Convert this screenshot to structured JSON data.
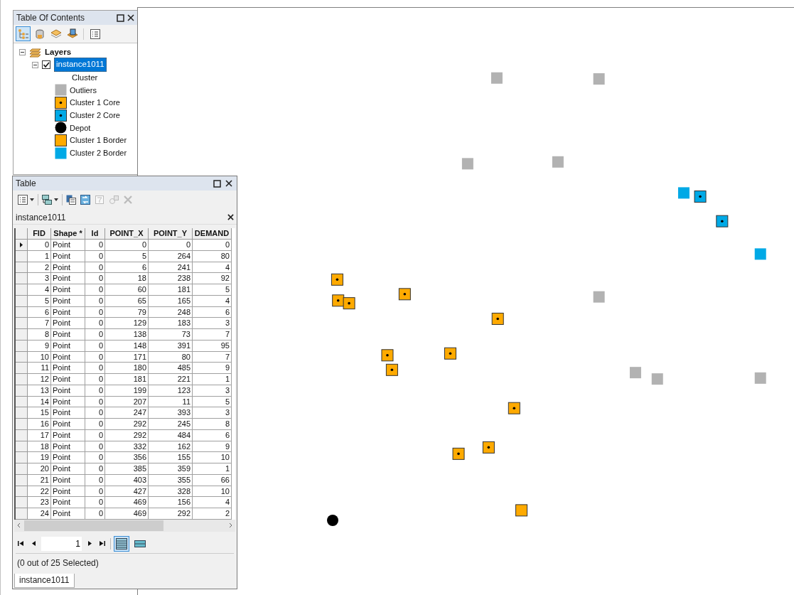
{
  "toc": {
    "title": "Table Of Contents",
    "toolbar": [
      {
        "kind": "drawing-order",
        "selected": true
      },
      {
        "kind": "source",
        "selected": false
      },
      {
        "kind": "visibility",
        "selected": false
      },
      {
        "kind": "selection",
        "selected": false
      },
      {
        "kind": "options",
        "selected": false
      }
    ],
    "tree": [
      {
        "label": "Layers",
        "expanded": true,
        "children": [
          {
            "label": "instance1011",
            "expanded": true,
            "checked": true,
            "selected": true,
            "field": "Cluster",
            "legend": [
              {
                "label": "Outliers",
                "kind": "square",
                "color": "#b2b2b2",
                "outline": false
              },
              {
                "label": "Cluster 1 Core",
                "kind": "dot-square",
                "color": "#ffaa00",
                "outline": true
              },
              {
                "label": "Cluster 2 Core",
                "kind": "dot-square",
                "color": "#00a9e6",
                "outline": true
              },
              {
                "label": "Depot",
                "kind": "circle",
                "color": "#000000",
                "outline": false
              },
              {
                "label": "Cluster 1 Border",
                "kind": "square",
                "color": "#ffaa00",
                "outline": true
              },
              {
                "label": "Cluster 2 Border",
                "kind": "square",
                "color": "#00a9e6",
                "outline": false
              }
            ]
          }
        ]
      }
    ]
  },
  "table": {
    "title": "Table",
    "tab": "instance1011",
    "tools": [
      {
        "kind": "options",
        "disabled": false
      },
      {
        "kind": "related",
        "disabled": false
      },
      {
        "kind": "select-by-attributes",
        "disabled": false
      },
      {
        "kind": "switch-selection",
        "disabled": false
      },
      {
        "kind": "clear-selection",
        "disabled": true
      },
      {
        "kind": "zoom-selected",
        "disabled": true
      },
      {
        "kind": "delete",
        "disabled": true
      }
    ],
    "columns": [
      {
        "label": "FID",
        "kind": "number"
      },
      {
        "label": "Shape *",
        "kind": "text"
      },
      {
        "label": "Id",
        "kind": "number"
      },
      {
        "label": "POINT_X",
        "kind": "number"
      },
      {
        "label": "POINT_Y",
        "kind": "number"
      },
      {
        "label": "DEMAND",
        "kind": "number"
      }
    ],
    "rows": [
      {
        "current": true,
        "cells": [
          "0",
          "Point",
          "0",
          "0",
          "0",
          "0"
        ]
      },
      {
        "current": false,
        "cells": [
          "1",
          "Point",
          "0",
          "5",
          "264",
          "80"
        ]
      },
      {
        "current": false,
        "cells": [
          "2",
          "Point",
          "0",
          "6",
          "241",
          "4"
        ]
      },
      {
        "current": false,
        "cells": [
          "3",
          "Point",
          "0",
          "18",
          "238",
          "92"
        ]
      },
      {
        "current": false,
        "cells": [
          "4",
          "Point",
          "0",
          "60",
          "181",
          "5"
        ]
      },
      {
        "current": false,
        "cells": [
          "5",
          "Point",
          "0",
          "65",
          "165",
          "4"
        ]
      },
      {
        "current": false,
        "cells": [
          "6",
          "Point",
          "0",
          "79",
          "248",
          "6"
        ]
      },
      {
        "current": false,
        "cells": [
          "7",
          "Point",
          "0",
          "129",
          "183",
          "3"
        ]
      },
      {
        "current": false,
        "cells": [
          "8",
          "Point",
          "0",
          "138",
          "73",
          "7"
        ]
      },
      {
        "current": false,
        "cells": [
          "9",
          "Point",
          "0",
          "148",
          "391",
          "95"
        ]
      },
      {
        "current": false,
        "cells": [
          "10",
          "Point",
          "0",
          "171",
          "80",
          "7"
        ]
      },
      {
        "current": false,
        "cells": [
          "11",
          "Point",
          "0",
          "180",
          "485",
          "9"
        ]
      },
      {
        "current": false,
        "cells": [
          "12",
          "Point",
          "0",
          "181",
          "221",
          "1"
        ]
      },
      {
        "current": false,
        "cells": [
          "13",
          "Point",
          "0",
          "199",
          "123",
          "3"
        ]
      },
      {
        "current": false,
        "cells": [
          "14",
          "Point",
          "0",
          "207",
          "11",
          "5"
        ]
      },
      {
        "current": false,
        "cells": [
          "15",
          "Point",
          "0",
          "247",
          "393",
          "3"
        ]
      },
      {
        "current": false,
        "cells": [
          "16",
          "Point",
          "0",
          "292",
          "245",
          "8"
        ]
      },
      {
        "current": false,
        "cells": [
          "17",
          "Point",
          "0",
          "292",
          "484",
          "6"
        ]
      },
      {
        "current": false,
        "cells": [
          "18",
          "Point",
          "0",
          "332",
          "162",
          "9"
        ]
      },
      {
        "current": false,
        "cells": [
          "19",
          "Point",
          "0",
          "356",
          "155",
          "10"
        ]
      },
      {
        "current": false,
        "cells": [
          "20",
          "Point",
          "0",
          "385",
          "359",
          "1"
        ]
      },
      {
        "current": false,
        "cells": [
          "21",
          "Point",
          "0",
          "403",
          "355",
          "66"
        ]
      },
      {
        "current": false,
        "cells": [
          "22",
          "Point",
          "0",
          "427",
          "328",
          "10"
        ]
      },
      {
        "current": false,
        "cells": [
          "23",
          "Point",
          "0",
          "469",
          "156",
          "4"
        ]
      },
      {
        "current": false,
        "cells": [
          "24",
          "Point",
          "0",
          "469",
          "292",
          "2"
        ]
      }
    ],
    "page": "1",
    "views": [
      {
        "kind": "all",
        "selected": true
      },
      {
        "kind": "selected",
        "selected": false
      }
    ],
    "status": "(0 out of 25 Selected)",
    "bottom_tabs": [
      {
        "label": "instance1011",
        "selected": true
      }
    ]
  },
  "map": {
    "points": [
      {
        "kind": "circle",
        "color": "#000000",
        "outline": false
      },
      {
        "kind": "dot-square",
        "color": "#ffaa00",
        "outline": true
      },
      {
        "kind": "dot-square",
        "color": "#ffaa00",
        "outline": true
      },
      {
        "kind": "dot-square",
        "color": "#ffaa00",
        "outline": true
      },
      {
        "kind": "dot-square",
        "color": "#ffaa00",
        "outline": true
      },
      {
        "kind": "dot-square",
        "color": "#ffaa00",
        "outline": true
      },
      {
        "kind": "dot-square",
        "color": "#ffaa00",
        "outline": true
      },
      {
        "kind": "dot-square",
        "color": "#ffaa00",
        "outline": true
      },
      {
        "kind": "dot-square",
        "color": "#ffaa00",
        "outline": true
      },
      {
        "kind": "square",
        "color": "#b2b2b2",
        "outline": false
      },
      {
        "kind": "dot-square",
        "color": "#ffaa00",
        "outline": true
      },
      {
        "kind": "square",
        "color": "#b2b2b2",
        "outline": false
      },
      {
        "kind": "dot-square",
        "color": "#ffaa00",
        "outline": true
      },
      {
        "kind": "dot-square",
        "color": "#ffaa00",
        "outline": true
      },
      {
        "kind": "square",
        "color": "#ffaa00",
        "outline": true
      },
      {
        "kind": "square",
        "color": "#b2b2b2",
        "outline": false
      },
      {
        "kind": "square",
        "color": "#b2b2b2",
        "outline": false
      },
      {
        "kind": "square",
        "color": "#b2b2b2",
        "outline": false
      },
      {
        "kind": "square",
        "color": "#b2b2b2",
        "outline": false
      },
      {
        "kind": "square",
        "color": "#b2b2b2",
        "outline": false
      },
      {
        "kind": "square",
        "color": "#00a9e6",
        "outline": false
      },
      {
        "kind": "dot-square",
        "color": "#00a9e6",
        "outline": true
      },
      {
        "kind": "dot-square",
        "color": "#00a9e6",
        "outline": true
      },
      {
        "kind": "square",
        "color": "#b2b2b2",
        "outline": false
      },
      {
        "kind": "square",
        "color": "#00a9e6",
        "outline": false
      }
    ]
  }
}
